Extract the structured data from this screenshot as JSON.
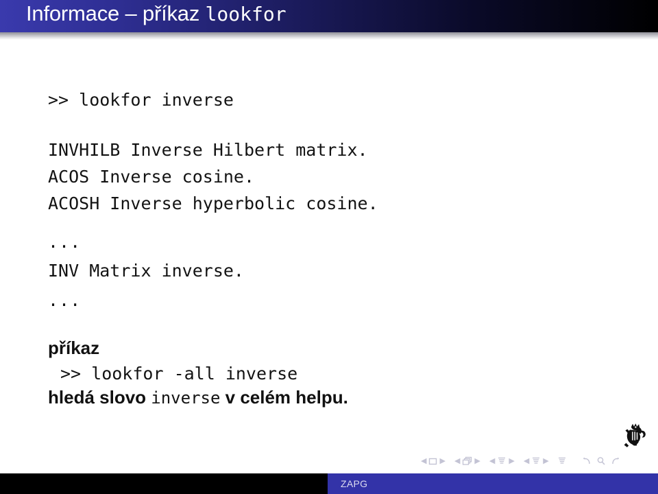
{
  "slide": {
    "title": {
      "text": "Informace – příkaz ",
      "mono_suffix": "lookfor"
    },
    "body": {
      "prompt_line": ">> lookfor inverse",
      "output_lines": [
        "INVHILB Inverse Hilbert matrix.",
        "ACOS Inverse cosine.",
        "ACOSH Inverse hyperbolic cosine."
      ],
      "ellipsis_1": "...",
      "output_line_4": "INV Matrix inverse.",
      "ellipsis_2": "...",
      "section_label": "příkaz",
      "command_line": ">> lookfor -all inverse",
      "description": {
        "part1": "hledá slovo ",
        "mono": "inverse",
        "part2": " v celém helpu."
      }
    }
  },
  "footer": {
    "label": "ZAPG"
  },
  "navigation": {
    "arrow_left": "◀",
    "arrow_right": "▶",
    "groups": [
      {
        "name": "slide-nav",
        "icon": "slide-icon"
      },
      {
        "name": "frame-nav",
        "icon": "frame-icon"
      },
      {
        "name": "subsection-nav",
        "icon": "subsection-icon"
      },
      {
        "name": "section-nav",
        "icon": "section-icon"
      }
    ],
    "presentation_icon": "presentation-icon",
    "tools": [
      {
        "name": "back-icon"
      },
      {
        "name": "search-icon"
      },
      {
        "name": "forward-icon"
      }
    ]
  },
  "logo": {
    "name": "ctu-lion-emblem"
  },
  "colors": {
    "title_gradient_start": "#3A3AAD",
    "title_gradient_end": "#000000",
    "footer_blue": "#3333A8",
    "footer_black": "#000000",
    "nav_symbol": "#c3c3d4",
    "text": "#131313"
  }
}
